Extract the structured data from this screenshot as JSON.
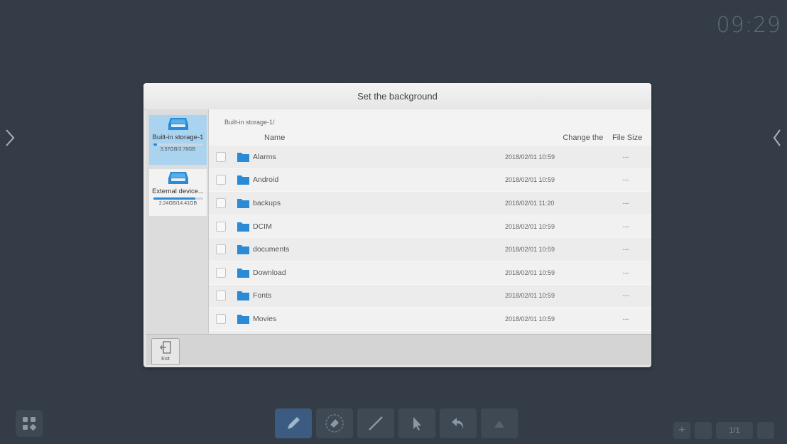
{
  "clock": "09:29",
  "dialog": {
    "title": "Set the background",
    "path": "Built-in storage-1/",
    "columns": {
      "name": "Name",
      "date": "Change the",
      "size": "File Size"
    },
    "storage": [
      {
        "label": "Built-in storage-1",
        "usage": "3.57GB/3.78GB",
        "used_fraction": 0.08
      },
      {
        "label": "External device...",
        "usage": "2.24GB/14.41GB",
        "used_fraction": 0.85
      }
    ],
    "files": [
      {
        "name": "Alarms",
        "date": "2018/02/01 10:59",
        "size": "---"
      },
      {
        "name": "Android",
        "date": "2018/02/01 10:59",
        "size": "---"
      },
      {
        "name": "backups",
        "date": "2018/02/01 11:20",
        "size": "---"
      },
      {
        "name": "DCIM",
        "date": "2018/02/01 10:59",
        "size": "---"
      },
      {
        "name": "documents",
        "date": "2018/02/01 10:59",
        "size": "---"
      },
      {
        "name": "Download",
        "date": "2018/02/01 10:59",
        "size": "---"
      },
      {
        "name": "Fonts",
        "date": "2018/02/01 10:59",
        "size": "---"
      },
      {
        "name": "Movies",
        "date": "2018/02/01 10:59",
        "size": "---"
      },
      {
        "name": "",
        "date": "",
        "size": ""
      }
    ],
    "exit_label": "Exit"
  },
  "pager": {
    "add": "+",
    "page": "1/1"
  },
  "colors": {
    "background": "#343d47",
    "accent": "#2a8ad6",
    "folder": "#2a8ad6",
    "selected": "#a9d3ef"
  },
  "icons": [
    "chevron-right-icon",
    "chevron-left-icon",
    "drive-icon",
    "folder-icon",
    "exit-icon",
    "apps-grid-icon",
    "pen-icon",
    "eraser-icon",
    "line-icon",
    "pointer-icon",
    "undo-icon",
    "redo-icon"
  ]
}
